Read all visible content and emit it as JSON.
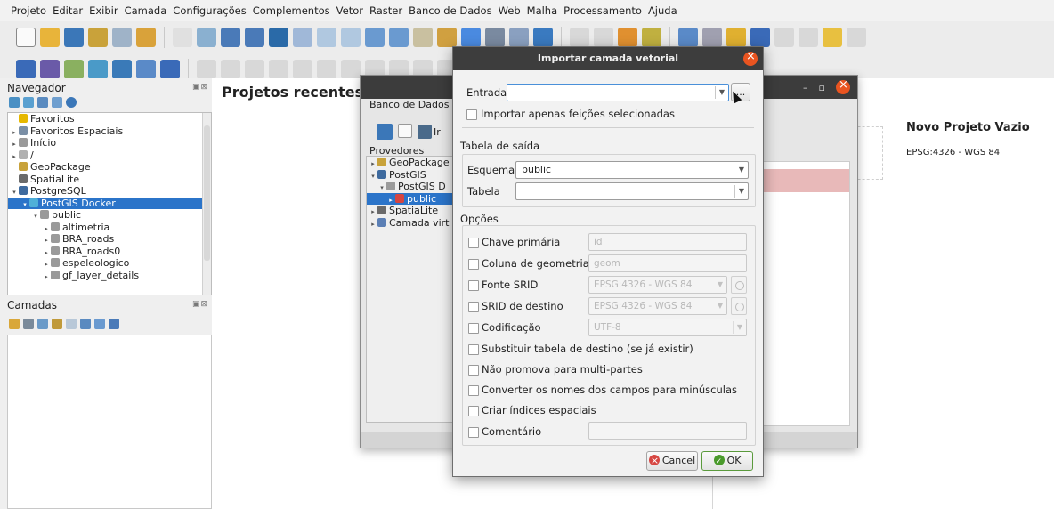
{
  "menubar": {
    "items": [
      "Projeto",
      "Editar",
      "Exibir",
      "Camada",
      "Configurações",
      "Complementos",
      "Vetor",
      "Raster",
      "Banco de Dados",
      "Web",
      "Malha",
      "Processamento",
      "Ajuda"
    ]
  },
  "navigator": {
    "title": "Navegador",
    "tree": [
      {
        "label": "Favoritos",
        "icon": "star-icon",
        "color": "#e6b800",
        "indent": 0,
        "arrow": ""
      },
      {
        "label": "Favoritos Espaciais",
        "icon": "spatial-bookmark-icon",
        "color": "#7a8fa6",
        "indent": 0,
        "arrow": "▸"
      },
      {
        "label": "Início",
        "icon": "home-folder-icon",
        "color": "#9a9a9a",
        "indent": 0,
        "arrow": "▸"
      },
      {
        "label": "/",
        "icon": "folder-icon",
        "color": "#b0b0b0",
        "indent": 0,
        "arrow": "▸"
      },
      {
        "label": "GeoPackage",
        "icon": "geopackage-icon",
        "color": "#c8a23a",
        "indent": 0,
        "arrow": ""
      },
      {
        "label": "SpatiaLite",
        "icon": "spatialite-icon",
        "color": "#6a6a6a",
        "indent": 0,
        "arrow": ""
      },
      {
        "label": "PostgreSQL",
        "icon": "postgresql-icon",
        "color": "#3e6a9e",
        "indent": 0,
        "arrow": "▾"
      },
      {
        "label": "PostGIS Docker",
        "icon": "connection-icon",
        "color": "#4fb0d8",
        "indent": 1,
        "arrow": "▾",
        "selected": true
      },
      {
        "label": "public",
        "icon": "schema-icon",
        "color": "#9a9a9a",
        "indent": 2,
        "arrow": "▾"
      },
      {
        "label": "altimetria",
        "icon": "line-layer-icon",
        "color": "#9a9a9a",
        "indent": 3,
        "arrow": "▸"
      },
      {
        "label": "BRA_roads",
        "icon": "line-layer-icon",
        "color": "#9a9a9a",
        "indent": 3,
        "arrow": "▸"
      },
      {
        "label": "BRA_roads0",
        "icon": "line-layer-icon",
        "color": "#9a9a9a",
        "indent": 3,
        "arrow": "▸"
      },
      {
        "label": "espeleologico",
        "icon": "point-layer-icon",
        "color": "#9a9a9a",
        "indent": 3,
        "arrow": "▸"
      },
      {
        "label": "gf_layer_details",
        "icon": "table-icon",
        "color": "#9a9a9a",
        "indent": 3,
        "arrow": "▸"
      }
    ]
  },
  "layers": {
    "title": "Camadas"
  },
  "recent": {
    "title": "Projetos recentes",
    "new_project_title": "Novo Projeto Vazio",
    "new_project_crs": "EPSG:4326 - WGS 84"
  },
  "dbmanager": {
    "menu_label": "Banco de Dados",
    "tool_label_fragment": "Ir",
    "providers_label": "Provedores",
    "tree": [
      {
        "label": "GeoPackage",
        "arrow": "▸",
        "indent": 0,
        "color": "#c8a23a"
      },
      {
        "label": "PostGIS",
        "arrow": "▾",
        "indent": 0,
        "color": "#3e6a9e"
      },
      {
        "label": "PostGIS D",
        "arrow": "▾",
        "indent": 1,
        "color": "#9a9a9a"
      },
      {
        "label": "public",
        "arrow": "▸",
        "indent": 2,
        "color": "#d64541",
        "selected": true
      },
      {
        "label": "SpatiaLite",
        "arrow": "▸",
        "indent": 0,
        "color": "#6a6a6a"
      },
      {
        "label": "Camada virt",
        "arrow": "▸",
        "indent": 0,
        "color": "#5b7fb5"
      }
    ]
  },
  "dialog": {
    "title": "Importar camada vetorial",
    "entrada_label": "Entrada",
    "entrada_value": "",
    "browse_label": "...",
    "import_selected_label": "Importar apenas feições selecionadas",
    "output_section": "Tabela de saída",
    "schema_label": "Esquema",
    "schema_value": "public",
    "table_label": "Tabela",
    "table_value": "",
    "options_section": "Opções",
    "primary_key_label": "Chave primária",
    "primary_key_value": "id",
    "geometry_column_label": "Coluna de geometria",
    "geometry_column_value": "geom",
    "source_srid_label": "Fonte SRID",
    "source_srid_value": "EPSG:4326 - WGS 84",
    "target_srid_label": "SRID de destino",
    "target_srid_value": "EPSG:4326 - WGS 84",
    "encoding_label": "Codificação",
    "encoding_value": "UTF-8",
    "replace_table_label": "Substituir tabela de destino (se já existir)",
    "no_multipart_label": "Não promova para multi-partes",
    "lowercase_fields_label": "Converter os nomes dos campos para minúsculas",
    "spatial_index_label": "Criar índices espaciais",
    "comment_label": "Comentário",
    "comment_value": "",
    "cancel_label": "Cancel",
    "ok_label": "OK"
  }
}
